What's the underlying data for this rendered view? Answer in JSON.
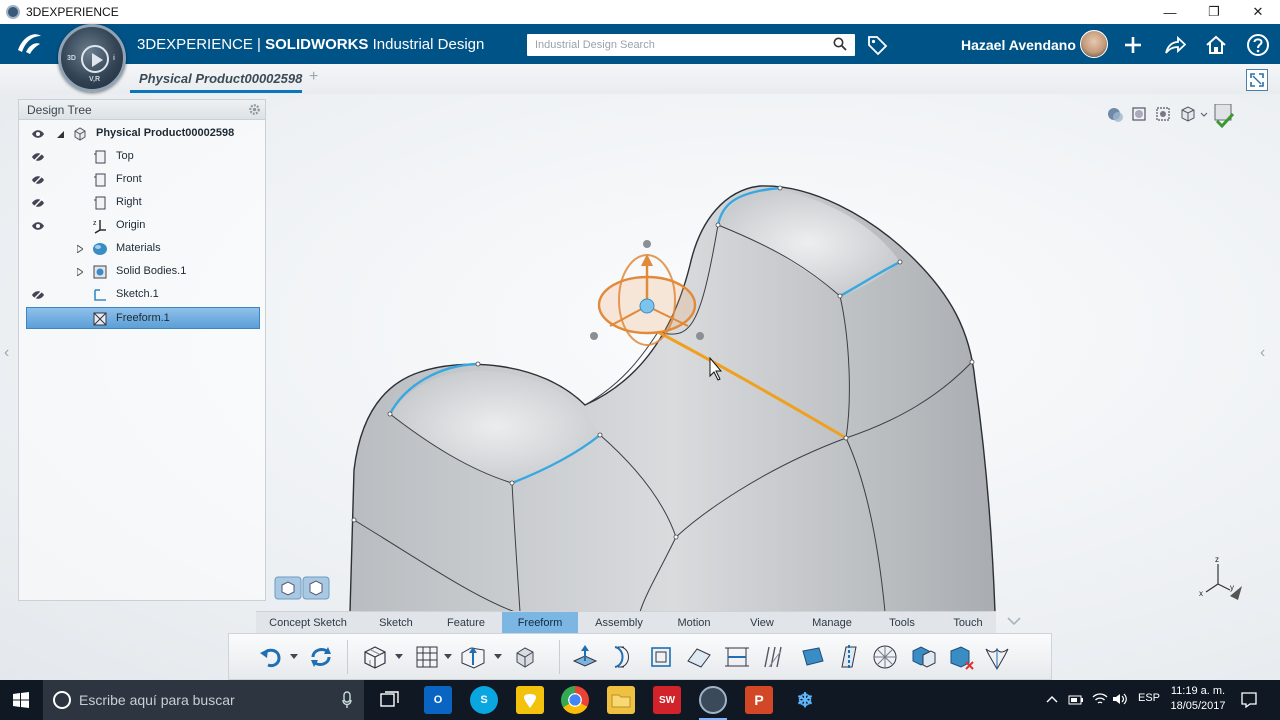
{
  "window": {
    "title": "3DEXPERIENCE",
    "controls": {
      "minimize": "—",
      "maximize": "❐",
      "close": "✕"
    }
  },
  "topbar": {
    "brand_prefix": "3DEXPERIENCE | ",
    "brand_app": "SOLIDWORKS",
    "brand_suffix": " Industrial Design",
    "search_placeholder": "Industrial Design Search",
    "user_name": "Hazael Avendano",
    "compass_labels": {
      "left": "3D",
      "right": "i",
      "bottom": "V,R"
    }
  },
  "tabs": [
    {
      "label": "Physical Product00002598"
    }
  ],
  "design_tree": {
    "title": "Design Tree",
    "items": [
      {
        "label": "Physical Product00002598",
        "bold": true
      },
      {
        "label": "Top"
      },
      {
        "label": "Front"
      },
      {
        "label": "Right"
      },
      {
        "label": "Origin"
      },
      {
        "label": "Materials"
      },
      {
        "label": "Solid Bodies.1"
      },
      {
        "label": "Sketch.1"
      },
      {
        "label": "Freeform.1",
        "selected": true
      }
    ]
  },
  "triad": {
    "z": "z",
    "x": "x",
    "y": "y"
  },
  "action_bar": {
    "tabs": [
      "Concept Sketch",
      "Sketch",
      "Feature",
      "Freeform",
      "Assembly",
      "Motion",
      "View",
      "Manage",
      "Tools",
      "Touch"
    ],
    "active_tab": "Freeform"
  },
  "taskbar": {
    "search_placeholder": "Escribe aquí para buscar",
    "language": "ESP",
    "time": "11:19 a. m.",
    "date": "18/05/2017",
    "sw_badge": "SW",
    "ppt_badge": "P"
  },
  "colors": {
    "appbar": "#005386",
    "selection": "#5b9fd8",
    "active_tab": "#7cb6e3",
    "edge_highlight": "#3aa8e0",
    "selected_edge": "#f0a020",
    "manipulator": "#e08a3a"
  }
}
